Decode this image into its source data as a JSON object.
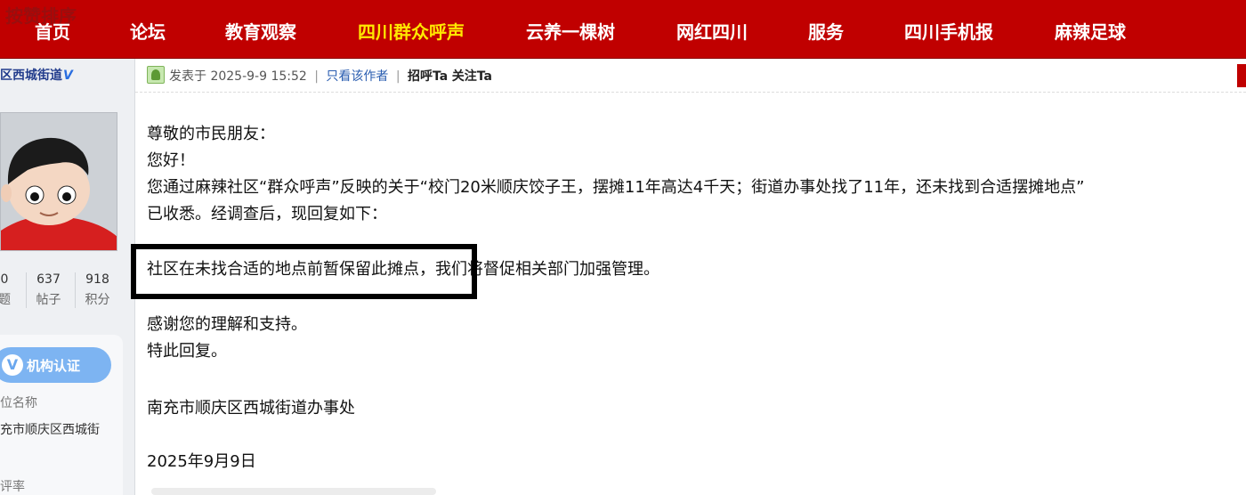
{
  "top_nav": {
    "ghost_text_faint": "",
    "ghost_text": "按赞排序",
    "items": [
      {
        "label": "首页"
      },
      {
        "label": "论坛"
      },
      {
        "label": "教育观察"
      },
      {
        "label": "四川群众呼声",
        "active": true
      },
      {
        "label": "云养一棵树"
      },
      {
        "label": "网红四川"
      },
      {
        "label": "服务"
      },
      {
        "label": "四川手机报"
      },
      {
        "label": "麻辣足球"
      }
    ],
    "background_color": "#c00000",
    "active_color": "#ffe800"
  },
  "sidebar": {
    "username": "区西城街道",
    "verified_mark": "V",
    "stats": [
      {
        "value": "0",
        "label": "题"
      },
      {
        "value": "637",
        "label": "帖子"
      },
      {
        "value": "918",
        "label": "积分"
      }
    ],
    "cert_button_label": "机构认证",
    "cert_field_label": "位名称",
    "cert_field_value": "充市顺庆区西城街",
    "cert_field_label_2": "评率"
  },
  "post": {
    "posted_prefix": "发表于",
    "posted_time": "2025-9-9 15:52",
    "only_author": "只看该作者",
    "greet": "招呼Ta",
    "follow": "关注Ta",
    "lines": [
      "尊敬的市民朋友：",
      "您好！",
      "您通过麻辣社区“群众呼声”反映的关于“校门20米顺庆饺子王，摆摊11年高达4千天；街道办事处找了11年，还未找到合适摆摊地点”",
      "已收悉。经调查后，现回复如下："
    ],
    "highlighted_text": "社区在未找合适的地点前暂保留此摊点，",
    "highlight_rest": "我们将督促相关部门加强管理。",
    "closing": [
      "感谢您的理解和支持。",
      "特此回复。"
    ],
    "signature": "南充市顺庆区西城街道办事处",
    "date": "2025年9月9日"
  }
}
